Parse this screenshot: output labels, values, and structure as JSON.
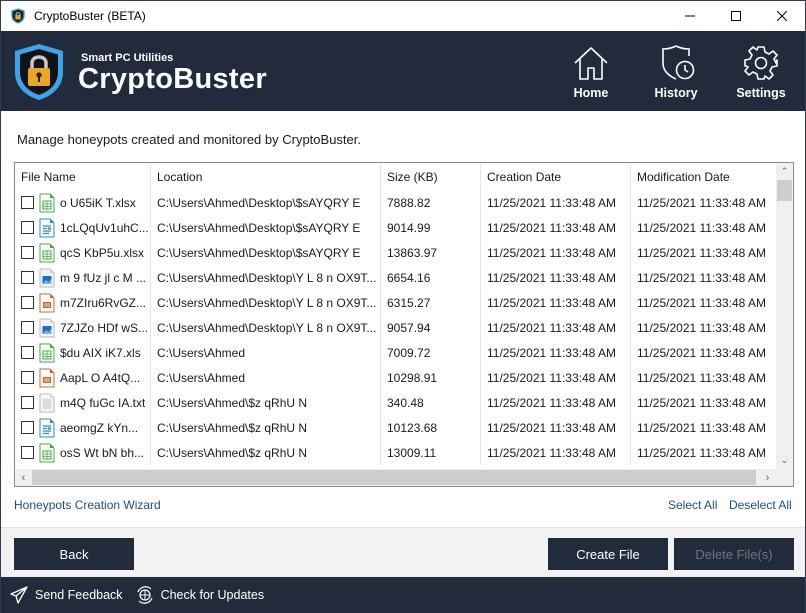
{
  "window": {
    "title": "CryptoBuster (BETA)",
    "controls": [
      "minimize",
      "maximize",
      "close"
    ]
  },
  "header": {
    "brand_subtitle": "Smart PC Utilities",
    "brand_title": "CryptoBuster",
    "nav": [
      {
        "label": "Home",
        "icon": "home-icon"
      },
      {
        "label": "History",
        "icon": "history-shield-clock-icon"
      },
      {
        "label": "Settings",
        "icon": "gear-icon"
      }
    ]
  },
  "main": {
    "description": "Manage honeypots created and monitored by CryptoBuster.",
    "table": {
      "columns": [
        "File Name",
        "Location",
        "Size (KB)",
        "Creation Date",
        "Modification Date"
      ],
      "rows": [
        {
          "checked": false,
          "type": "spreadsheet",
          "name": "o U65iK T.xlsx",
          "location": "C:\\Users\\Ahmed\\Desktop\\$sAYQRY E",
          "size": "7888.82",
          "created": "11/25/2021 11:33:48 AM",
          "modified": "11/25/2021 11:33:48 AM"
        },
        {
          "checked": false,
          "type": "document",
          "name": "1cLQqUv1uhC...",
          "location": "C:\\Users\\Ahmed\\Desktop\\$sAYQRY E",
          "size": "9014.99",
          "created": "11/25/2021 11:33:48 AM",
          "modified": "11/25/2021 11:33:48 AM"
        },
        {
          "checked": false,
          "type": "spreadsheet",
          "name": "qcS KbP5u.xlsx",
          "location": "C:\\Users\\Ahmed\\Desktop\\$sAYQRY E",
          "size": "13863.97",
          "created": "11/25/2021 11:33:48 AM",
          "modified": "11/25/2021 11:33:48 AM"
        },
        {
          "checked": false,
          "type": "image",
          "name": "m 9 fUz jl c M ...",
          "location": "C:\\Users\\Ahmed\\Desktop\\Y L 8 n OX9T...",
          "size": "6654.16",
          "created": "11/25/2021 11:33:48 AM",
          "modified": "11/25/2021 11:33:48 AM"
        },
        {
          "checked": false,
          "type": "presentation",
          "name": "m7ZIru6RvGZ...",
          "location": "C:\\Users\\Ahmed\\Desktop\\Y L 8 n OX9T...",
          "size": "6315.27",
          "created": "11/25/2021 11:33:48 AM",
          "modified": "11/25/2021 11:33:48 AM"
        },
        {
          "checked": false,
          "type": "image",
          "name": "7ZJZo HDf wS...",
          "location": "C:\\Users\\Ahmed\\Desktop\\Y L 8 n OX9T...",
          "size": "9057.94",
          "created": "11/25/2021 11:33:48 AM",
          "modified": "11/25/2021 11:33:48 AM"
        },
        {
          "checked": false,
          "type": "spreadsheet",
          "name": "$du AIX iK7.xls",
          "location": "C:\\Users\\Ahmed",
          "size": "7009.72",
          "created": "11/25/2021 11:33:48 AM",
          "modified": "11/25/2021 11:33:48 AM"
        },
        {
          "checked": false,
          "type": "presentation",
          "name": "AapL O A4tQ...",
          "location": "C:\\Users\\Ahmed",
          "size": "10298.91",
          "created": "11/25/2021 11:33:48 AM",
          "modified": "11/25/2021 11:33:48 AM"
        },
        {
          "checked": false,
          "type": "text",
          "name": "m4Q fuGc IA.txt",
          "location": "C:\\Users\\Ahmed\\$z qRhU N",
          "size": "340.48",
          "created": "11/25/2021 11:33:48 AM",
          "modified": "11/25/2021 11:33:48 AM"
        },
        {
          "checked": false,
          "type": "document",
          "name": "aeomgZ kYn...",
          "location": "C:\\Users\\Ahmed\\$z qRhU N",
          "size": "10123.68",
          "created": "11/25/2021 11:33:48 AM",
          "modified": "11/25/2021 11:33:48 AM"
        },
        {
          "checked": false,
          "type": "spreadsheet",
          "name": "osS Wt bN bh...",
          "location": "C:\\Users\\Ahmed\\$z qRhU N",
          "size": "13009.11",
          "created": "11/25/2021 11:33:48 AM",
          "modified": "11/25/2021 11:33:48 AM"
        }
      ]
    },
    "wizard_link": "Honeypots Creation Wizard",
    "select_all": "Select All",
    "deselect_all": "Deselect All"
  },
  "actions": {
    "back": "Back",
    "create_file": "Create File",
    "delete_files": "Delete File(s)",
    "delete_enabled": false
  },
  "footer": {
    "send_feedback": "Send Feedback",
    "check_updates": "Check for Updates"
  },
  "colors": {
    "header_bg": "#212b3b",
    "link": "#1e4c8a",
    "button_bg": "#212b3b",
    "disabled_text": "#6d7480"
  }
}
